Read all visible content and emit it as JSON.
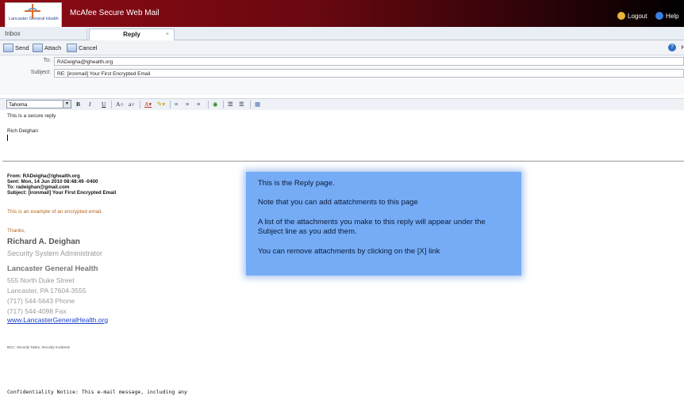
{
  "app": {
    "title": "McAfee Secure Web Mail",
    "logo_text": "Lancaster General Health"
  },
  "header": {
    "logout_label": "Logout",
    "help_label": "Help"
  },
  "tabs": [
    {
      "label": "Inbox"
    },
    {
      "label": "Reply",
      "close": "×"
    }
  ],
  "toolbar": {
    "send_label": "Send",
    "attach_label": "Attach",
    "cancel_label": "Cancel",
    "help_label": "H"
  },
  "fields": {
    "to_label": "To:",
    "to_value": "RADeigha@lghealth.org",
    "subject_label": "Subject:",
    "subject_value": "RE: [ironmail] Your First Encrypted Email"
  },
  "format": {
    "font": "Tahoma",
    "bold": "B",
    "italic": "I",
    "underline": "U"
  },
  "editor": {
    "line1": "This is a secure reply",
    "line2": "Rich Deighan",
    "quoted_from": "From: RADeigha@lghealth.org",
    "quoted_sent": "Sent: Mon, 14 Jun 2010 08:48:49 -0400",
    "quoted_to": "To: radeighan@gmail.com",
    "quoted_subject": "Subject: [ironmail] Your First Encrypted Email",
    "body_text": "This is an example of an encrypted email.",
    "thanks": "Thanks,",
    "sig_name": "Richard A. Deighan",
    "sig_title": "Security System Administrator",
    "sig_org": "Lancaster General Health",
    "sig_addr1": "555 North Duke Street",
    "sig_addr2": "Lancaster, PA 17604-3555",
    "sig_phone": "(717) 544-5643 Phone",
    "sig_fax": "(717) 544-4098 Fax",
    "sig_link": "www.LancasterGeneralHealth.org",
    "bcc": "BCC: Security Tasks; Security Incidents",
    "confidentiality": "Confidentiality Notice: This e-mail message, including any"
  },
  "callout": {
    "line1": "This is the Reply page.",
    "line2": "Note that you can add attatchments to this page",
    "line3": "A list of the attachments you make to this reply will appear under the Subject line as you add them.",
    "line4": "You can remove attachments by clicking on the [X] link"
  },
  "colors": {
    "header_red": "#8c0a14",
    "callout_blue": "#75acf5",
    "link_blue": "#1a3fc7",
    "orange_text": "#b5651d"
  }
}
